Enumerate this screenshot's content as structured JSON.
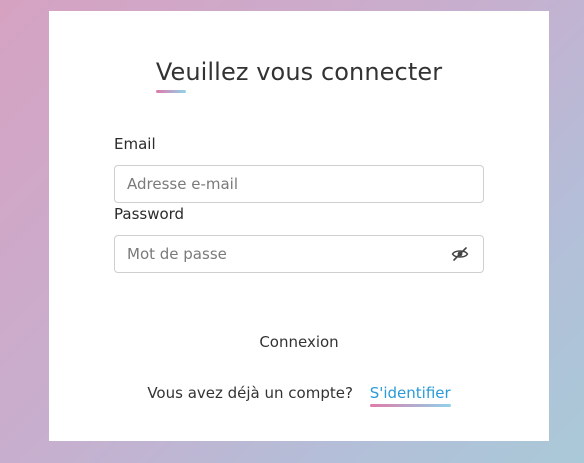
{
  "form": {
    "title": "Veuillez vous connecter",
    "email_label": "Email",
    "email_placeholder": "Adresse e-mail",
    "email_value": "",
    "password_label": "Password",
    "password_placeholder": "Mot de passe",
    "password_value": "",
    "submit_label": "Connexion"
  },
  "footer": {
    "prompt": "Vous avez déjà un compte?",
    "link_label": "S'identifier"
  },
  "icons": {
    "password_toggle": "eye-slash-icon"
  },
  "colors": {
    "link": "#2a9ad8",
    "accent_gradient_start": "#e07aa9",
    "accent_gradient_end": "#8fd3ea"
  }
}
